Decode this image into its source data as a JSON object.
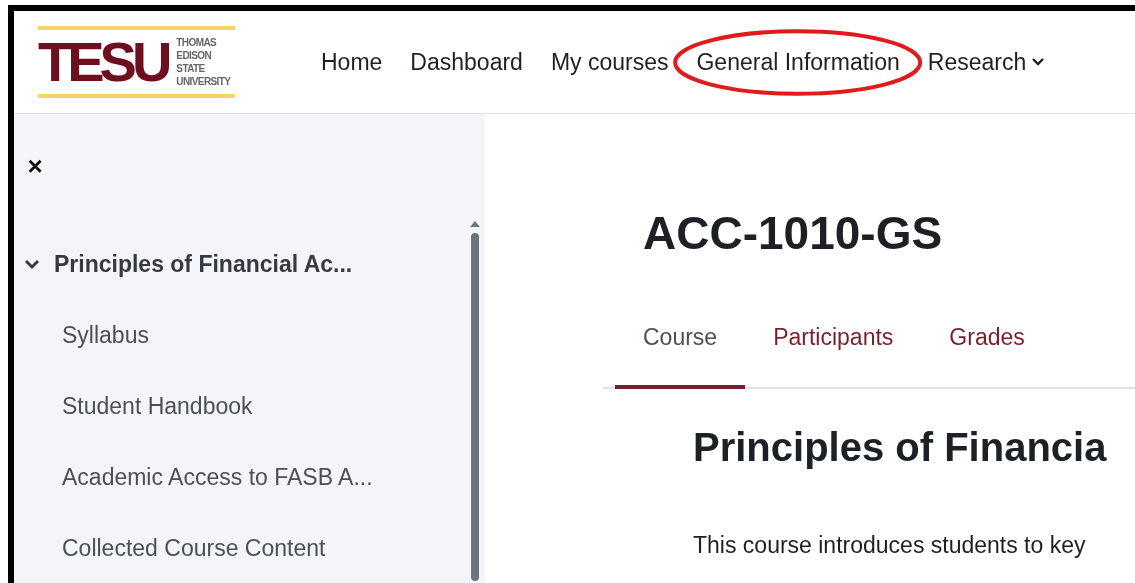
{
  "logo": {
    "mark": "TESU",
    "lines": [
      "THOMAS",
      "EDISON",
      "STATE",
      "UNIVERSITY"
    ]
  },
  "nav": [
    {
      "label": "Home",
      "highlighted": false,
      "dropdown": false
    },
    {
      "label": "Dashboard",
      "highlighted": false,
      "dropdown": false
    },
    {
      "label": "My courses",
      "highlighted": false,
      "dropdown": false
    },
    {
      "label": "General Information",
      "highlighted": true,
      "dropdown": false
    },
    {
      "label": "Research",
      "highlighted": false,
      "dropdown": true
    }
  ],
  "sidebar": {
    "close": "×",
    "tree": [
      {
        "label": "Principles of Financial Ac...",
        "expanded": true,
        "children": [
          {
            "label": "Syllabus"
          },
          {
            "label": "Student Handbook"
          },
          {
            "label": "Academic Access to FASB A..."
          },
          {
            "label": "Collected Course Content"
          }
        ]
      }
    ]
  },
  "course": {
    "title": "ACC-1010-GS",
    "tabs": [
      {
        "label": "Course",
        "selected": true
      },
      {
        "label": "Participants",
        "selected": false
      },
      {
        "label": "Grades",
        "selected": false
      }
    ],
    "heading": "Principles of Financia",
    "intro": "This course introduces students to key"
  }
}
